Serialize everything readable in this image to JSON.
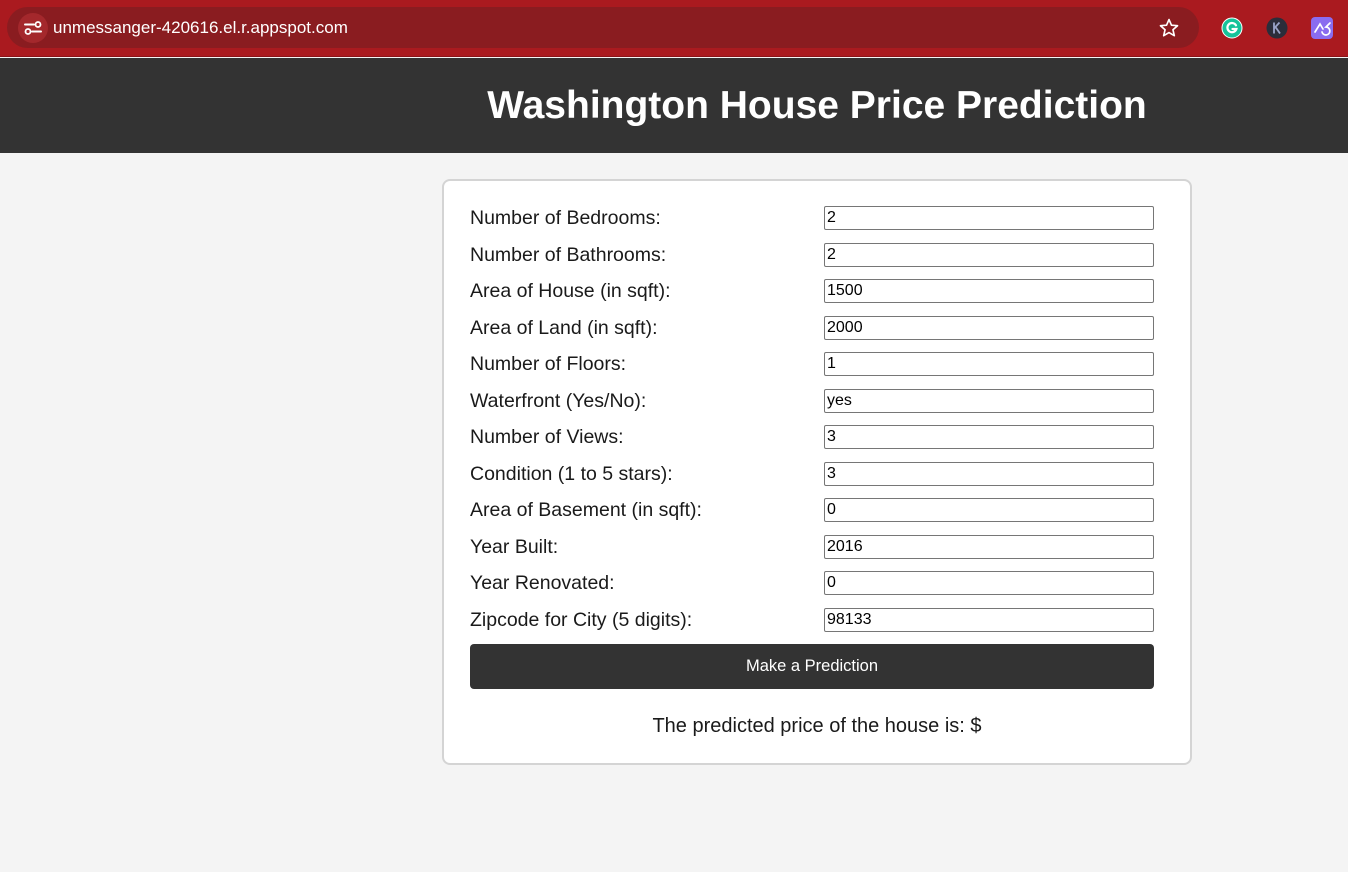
{
  "browser": {
    "url": "unmessanger-420616.el.r.appspot.com",
    "extensions": [
      "grammarly-icon",
      "k-extension-icon",
      "purple-extension-icon"
    ],
    "accent_color": "#aa1a1f"
  },
  "header": {
    "title": "Washington House Price Prediction",
    "background": "#333333"
  },
  "form": {
    "fields": [
      {
        "label": "Number of Bedrooms:",
        "value": "2"
      },
      {
        "label": "Number of Bathrooms:",
        "value": "2"
      },
      {
        "label": "Area of House (in sqft):",
        "value": "1500"
      },
      {
        "label": "Area of Land (in sqft):",
        "value": "2000"
      },
      {
        "label": "Number of Floors:",
        "value": "1"
      },
      {
        "label": "Waterfront (Yes/No):",
        "value": "yes"
      },
      {
        "label": "Number of Views:",
        "value": "3"
      },
      {
        "label": "Condition (1 to 5 stars):",
        "value": "3"
      },
      {
        "label": "Area of Basement (in sqft):",
        "value": "0"
      },
      {
        "label": "Year Built:",
        "value": "2016"
      },
      {
        "label": "Year Renovated:",
        "value": "0"
      },
      {
        "label": "Zipcode for City (5 digits):",
        "value": "98133"
      }
    ],
    "submit_label": "Make a Prediction",
    "result_text": "The predicted price of the house is: $"
  }
}
